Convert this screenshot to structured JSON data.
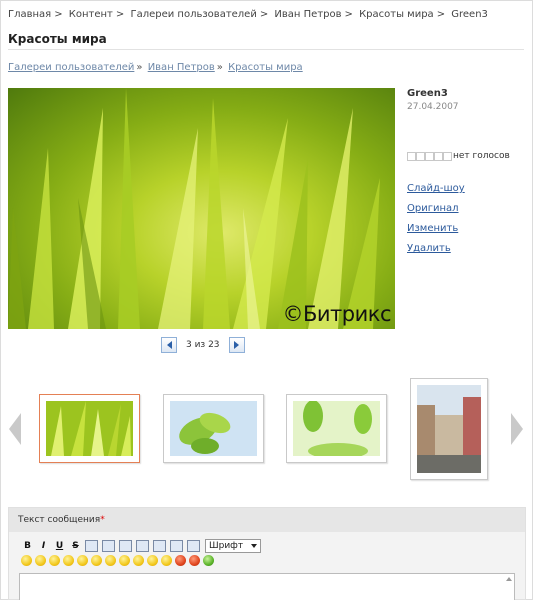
{
  "breadcrumb": [
    "Главная",
    "Контент",
    "Галереи пользователей",
    "Иван Петров",
    "Красоты мира",
    "Green3"
  ],
  "page_title": "Красоты мира",
  "sublinks": [
    "Галереи пользователей",
    "Иван Петров",
    "Красоты мира"
  ],
  "photo": {
    "name": "Green3",
    "date": "27.04.2007",
    "watermark": "©Битрикс",
    "votes": "нет голосов",
    "rating_stars": 5
  },
  "actions": [
    "Слайд-шоу",
    "Оригинал",
    "Изменить",
    "Удалить"
  ],
  "pager": {
    "current": "3 из 23"
  },
  "form": {
    "label": "Текст сообщения",
    "required_mark": "*",
    "toolbar": {
      "bold": "B",
      "italic": "I",
      "underline": "U",
      "strike": "S",
      "font_select": "Шрифт"
    }
  },
  "colors": {
    "link": "#2c5a9c",
    "crumb_link": "#6e88a8",
    "selected_thumb": "#e48055",
    "required": "#dd0000"
  }
}
